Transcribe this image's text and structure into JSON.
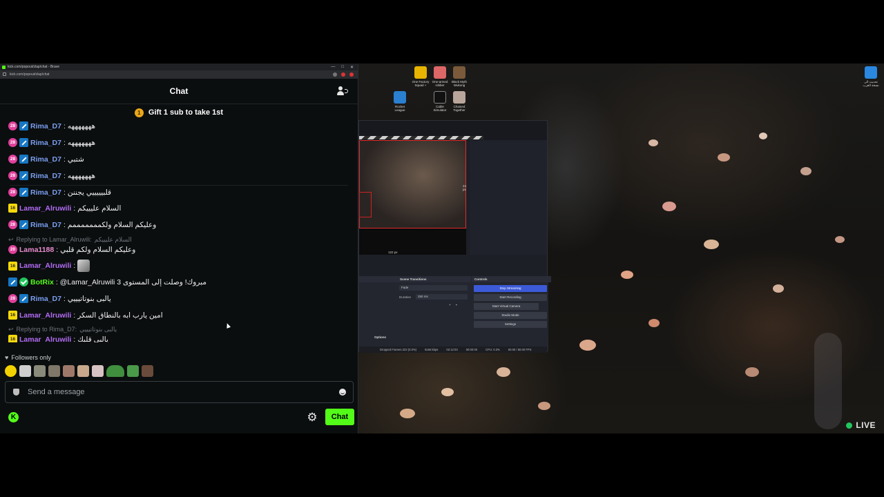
{
  "browser": {
    "window_title": "kick.com/popout/zlap/chat - Brave",
    "url": "kick.com/popout/zlap/chat",
    "window_controls": [
      "—",
      "□",
      "✕"
    ]
  },
  "chat": {
    "title": "Chat",
    "pinned": {
      "badge": "1",
      "text": "Gift 1 sub to take 1st"
    },
    "messages": [
      {
        "badge": "28",
        "user": "Rima_D7",
        "sep": ":",
        "text": "هههههههه",
        "mod": true
      },
      {
        "badge": "28",
        "user": "Rima_D7",
        "sep": ":",
        "text": "هههههههه",
        "mod": true
      },
      {
        "badge": "28",
        "user": "Rima_D7",
        "sep": ":",
        "text": "شتبي",
        "mod": true
      },
      {
        "badge": "28",
        "user": "Rima_D7",
        "sep": ":",
        "text": "هههههههه",
        "mod": true
      },
      {
        "badge": "28",
        "user": "Rima_D7",
        "sep": ":",
        "text": "قلبيييييي يجننن",
        "mod": true
      },
      {
        "badge": "16",
        "user": "Lamar_Alruwili",
        "sep": ":",
        "text": "السلام عليييكم"
      },
      {
        "badge": "28",
        "user": "Rima_D7",
        "sep": ":",
        "text": "وعليكم السلام ولكمممممممم",
        "mod": true
      },
      {
        "reply": "Replying to Lamar_Alruwili:",
        "reply_text": "السلام عليييكم"
      },
      {
        "badge": "20",
        "user": "Lama1188",
        "sep": ":",
        "text": "وعليكم السلام ولكم قلبي"
      },
      {
        "badge": "16",
        "user": "Lamar_Alruwili",
        "sep": ":",
        "text": ""
      },
      {
        "user": "BotRix",
        "sep": ":",
        "text": "@Lamar_Alruwili مبروك! وصلت إلى المستوى 3",
        "mod": true,
        "verified": true
      },
      {
        "badge": "28",
        "user": "Rima_D7",
        "sep": ":",
        "text": "يالبى بنوتاتيييي",
        "mod": true
      },
      {
        "badge": "16",
        "user": "Lamar_Alruwili",
        "sep": ":",
        "text": "امين يارب ابه بالنطاق السكر"
      },
      {
        "reply": "Replying to Rima_D7:",
        "reply_text": "يالبى بنوتاتيييي"
      },
      {
        "badge": "16",
        "user": "Lamar_Alruwili",
        "sep": ":",
        "text": "يالبى قلبك"
      }
    ],
    "followers_only": "Followers only",
    "input_placeholder": "Send a message",
    "send_label": "Chat"
  },
  "colors": {
    "brand_green": "#53fc18",
    "rima": "#7b9ff0",
    "lamar": "#b36df5",
    "lama": "#e98ccf",
    "botrix": "#53fc18"
  },
  "desktop": {
    "icons": [
      "One Factory Squad +",
      "One-armed robber",
      "Black Myth Wukong",
      "Rocket League",
      "Cable Simulator",
      "Chained Together"
    ],
    "right_icon": "تحديث الى نسخة العرب"
  },
  "obs": {
    "preview_w_label": "24 px",
    "preview_h_label": "122 px",
    "scene_transitions": "Scene Transitions",
    "controls": "Controls",
    "fade": "Fade",
    "duration_label": "Duration",
    "duration_value": "250 ms",
    "buttons": [
      "Stop Streaming",
      "Start Recording",
      "Start Virtual Camera",
      "Studio Mode",
      "Settings"
    ],
    "options": "Options",
    "status": [
      "Dropped Frames 223 (0.0%)",
      "6156 kbps",
      "02:12:03",
      "00:00:00",
      "CPU: 0.3%",
      "60.00 / 60.00 FPS"
    ]
  },
  "live_label": "LIVE"
}
